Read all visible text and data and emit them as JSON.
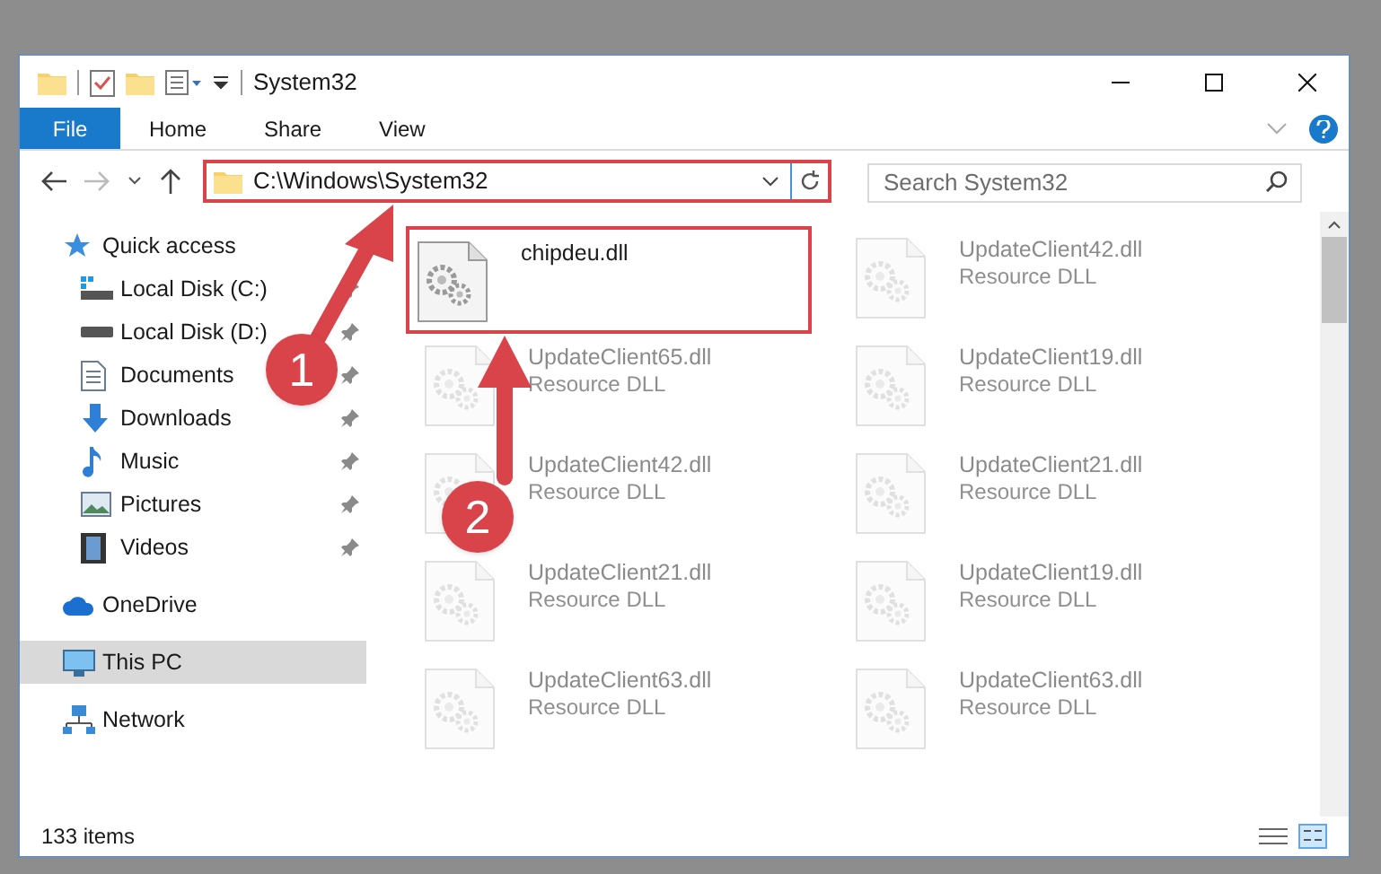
{
  "window": {
    "title": "System32"
  },
  "ribbon": {
    "tabs": [
      {
        "label": "File",
        "kind": "menu",
        "selected": false
      },
      {
        "label": "Home",
        "kind": "tab",
        "selected": false
      },
      {
        "label": "Share",
        "kind": "tab",
        "selected": false
      },
      {
        "label": "View",
        "kind": "tab",
        "selected": false
      }
    ]
  },
  "address_bar": {
    "path": "C:\\Windows\\System32",
    "search": {
      "placeholder": "Search System32"
    }
  },
  "sidebar": {
    "items": [
      {
        "label": "Quick access",
        "selected": false,
        "children": [
          {
            "label": "Local Disk (C:)",
            "pinned": true,
            "selected": false
          },
          {
            "label": "Local Disk (D:)",
            "pinned": true,
            "selected": false
          },
          {
            "label": "Documents",
            "pinned": true,
            "selected": false
          },
          {
            "label": "Downloads",
            "pinned": true,
            "selected": false
          },
          {
            "label": "Music",
            "pinned": true,
            "selected": false
          },
          {
            "label": "Pictures",
            "pinned": true,
            "selected": false
          },
          {
            "label": "Videos",
            "pinned": true,
            "selected": false
          }
        ]
      },
      {
        "label": "OneDrive",
        "selected": false
      },
      {
        "label": "This PC",
        "selected": true
      },
      {
        "label": "Network",
        "selected": false
      }
    ]
  },
  "files": [
    {
      "name": "chipdeu.dll",
      "blurred": false
    },
    {
      "name": "UpdateClient42.dll",
      "type": "Resource DLL",
      "blurred": true
    },
    {
      "name": "UpdateClient65.dll",
      "type": "Resource DLL",
      "blurred": true
    },
    {
      "name": "UpdateClient19.dll",
      "type": "Resource DLL",
      "blurred": true
    },
    {
      "name": "UpdateClient42.dll",
      "type": "Resource DLL",
      "blurred": true
    },
    {
      "name": "UpdateClient21.dll",
      "type": "Resource DLL",
      "blurred": true
    },
    {
      "name": "UpdateClient21.dll",
      "type": "Resource DLL",
      "blurred": true
    },
    {
      "name": "UpdateClient19.dll",
      "type": "Resource DLL",
      "blurred": true
    },
    {
      "name": "UpdateClient63.dll",
      "type": "Resource DLL",
      "blurred": true
    },
    {
      "name": "UpdateClient63.dll",
      "type": "Resource DLL",
      "blurred": true
    }
  ],
  "status_bar": {
    "count": "133 items"
  },
  "annotations": {
    "steps": [
      {
        "number": "1"
      },
      {
        "number": "2"
      }
    ]
  }
}
